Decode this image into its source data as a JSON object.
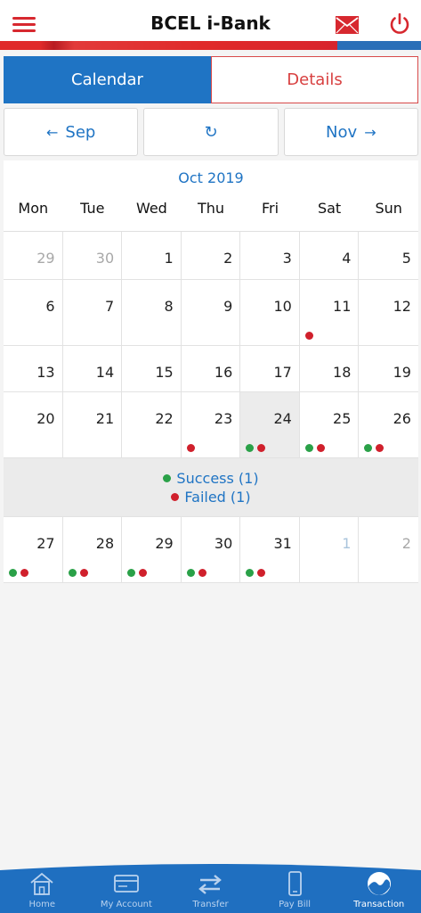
{
  "header": {
    "title": "BCEL i-Bank"
  },
  "tabs": {
    "calendar": "Calendar",
    "details": "Details"
  },
  "month_nav": {
    "prev": "Sep",
    "next": "Nov",
    "prev_arrow": "←",
    "next_arrow": "→",
    "refresh_glyph": "↻"
  },
  "calendar": {
    "month_title": "Oct 2019",
    "weekdays": [
      "Mon",
      "Tue",
      "Wed",
      "Thu",
      "Fri",
      "Sat",
      "Sun"
    ],
    "weeks": [
      [
        {
          "day": "29",
          "type": "other"
        },
        {
          "day": "30",
          "type": "other"
        },
        {
          "day": "1"
        },
        {
          "day": "2"
        },
        {
          "day": "3"
        },
        {
          "day": "4"
        },
        {
          "day": "5"
        }
      ],
      [
        {
          "day": "6"
        },
        {
          "day": "7"
        },
        {
          "day": "8"
        },
        {
          "day": "9"
        },
        {
          "day": "10"
        },
        {
          "day": "11",
          "dots": [
            "red"
          ]
        },
        {
          "day": "12"
        }
      ],
      [
        {
          "day": "13"
        },
        {
          "day": "14"
        },
        {
          "day": "15"
        },
        {
          "day": "16"
        },
        {
          "day": "17"
        },
        {
          "day": "18"
        },
        {
          "day": "19"
        }
      ],
      [
        {
          "day": "20"
        },
        {
          "day": "21"
        },
        {
          "day": "22"
        },
        {
          "day": "23",
          "dots": [
            "red"
          ]
        },
        {
          "day": "24",
          "dots": [
            "green",
            "red"
          ],
          "selected": true
        },
        {
          "day": "25",
          "dots": [
            "green",
            "red"
          ]
        },
        {
          "day": "26",
          "dots": [
            "green",
            "red"
          ]
        }
      ],
      [
        {
          "day": "27",
          "dots": [
            "green",
            "red"
          ]
        },
        {
          "day": "28",
          "dots": [
            "green",
            "red"
          ]
        },
        {
          "day": "29",
          "dots": [
            "green",
            "red"
          ]
        },
        {
          "day": "30",
          "dots": [
            "green",
            "red"
          ]
        },
        {
          "day": "31",
          "dots": [
            "green",
            "red"
          ]
        },
        {
          "day": "1",
          "type": "next"
        },
        {
          "day": "2",
          "type": "other"
        }
      ]
    ],
    "summary": {
      "success": "Success (1)",
      "failed": "Failed (1)"
    }
  },
  "bottom_nav": {
    "items": [
      {
        "label": "Home",
        "icon": "home-icon"
      },
      {
        "label": "My Account",
        "icon": "card-icon"
      },
      {
        "label": "Transfer",
        "icon": "transfer-icon"
      },
      {
        "label": "Pay Bill",
        "icon": "phone-icon"
      },
      {
        "label": "Transaction",
        "icon": "transaction-icon",
        "active": true
      }
    ]
  },
  "colors": {
    "accent_blue": "#1f74c4",
    "brand_red": "#d7282f",
    "success_green": "#2aa148",
    "failed_red": "#d0202c",
    "nav_blue": "#1f6fc0"
  }
}
